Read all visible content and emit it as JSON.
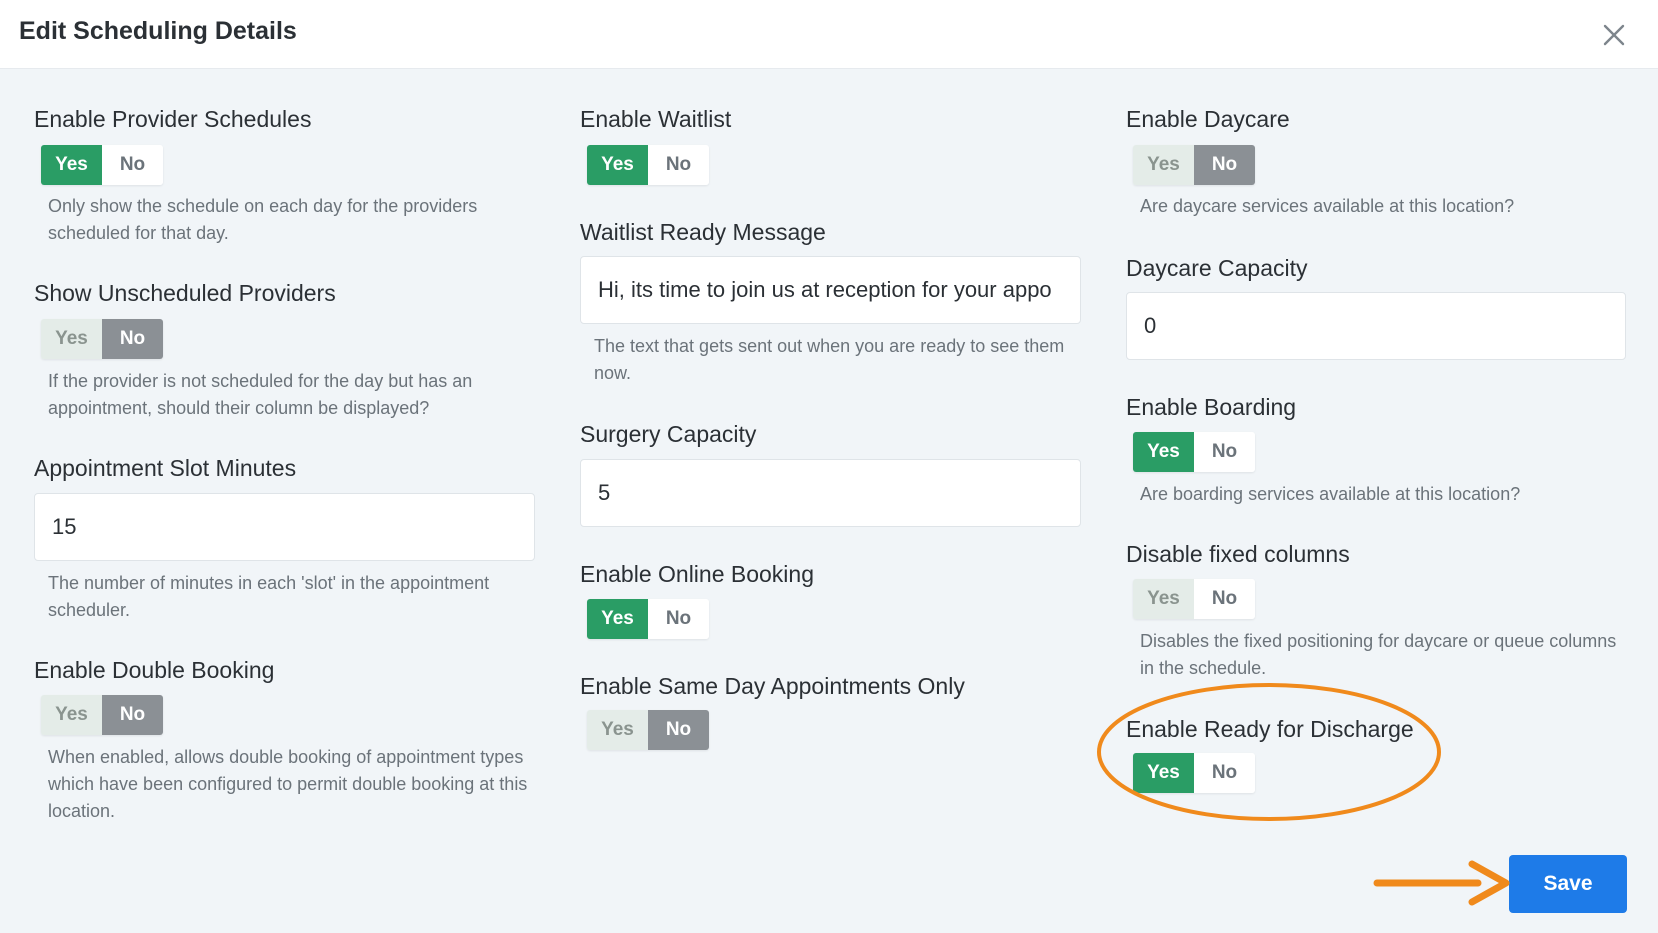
{
  "header": {
    "title": "Edit Scheduling Details"
  },
  "col1": {
    "provider_schedules": {
      "label": "Enable Provider Schedules",
      "yes": "Yes",
      "no": "No",
      "selected": "Yes",
      "help": "Only show the schedule on each day for the providers scheduled for that day."
    },
    "unscheduled_providers": {
      "label": "Show Unscheduled Providers",
      "yes": "Yes",
      "no": "No",
      "selected": "No",
      "help": "If the provider is not scheduled for the day but has an appointment, should their column be displayed?"
    },
    "slot_minutes": {
      "label": "Appointment Slot Minutes",
      "value": "15",
      "help": "The number of minutes in each 'slot' in the appointment scheduler."
    },
    "double_booking": {
      "label": "Enable Double Booking",
      "yes": "Yes",
      "no": "No",
      "selected": "No",
      "help": "When enabled, allows double booking of appointment types which have been configured to permit double booking at this location."
    }
  },
  "col2": {
    "waitlist": {
      "label": "Enable Waitlist",
      "yes": "Yes",
      "no": "No",
      "selected": "Yes"
    },
    "waitlist_message": {
      "label": "Waitlist Ready Message",
      "value": "Hi, its time to join us at reception for your appo",
      "help": "The text that gets sent out when you are ready to see them now."
    },
    "surgery_capacity": {
      "label": "Surgery Capacity",
      "value": "5"
    },
    "online_booking": {
      "label": "Enable Online Booking",
      "yes": "Yes",
      "no": "No",
      "selected": "Yes"
    },
    "same_day": {
      "label": "Enable Same Day Appointments Only",
      "yes": "Yes",
      "no": "No",
      "selected": "No"
    }
  },
  "col3": {
    "daycare": {
      "label": "Enable Daycare",
      "yes": "Yes",
      "no": "No",
      "selected": "No",
      "help": "Are daycare services available at this location?"
    },
    "daycare_capacity": {
      "label": "Daycare Capacity",
      "value": "0"
    },
    "boarding": {
      "label": "Enable Boarding",
      "yes": "Yes",
      "no": "No",
      "selected": "Yes",
      "help": "Are boarding services available at this location?"
    },
    "fixed_columns": {
      "label": "Disable fixed columns",
      "yes": "Yes",
      "no": "No",
      "selected": "none",
      "help": "Disables the fixed positioning for daycare or queue columns in the schedule."
    },
    "ready_discharge": {
      "label": "Enable Ready for Discharge",
      "yes": "Yes",
      "no": "No",
      "selected": "Yes"
    }
  },
  "footer": {
    "save_label": "Save"
  },
  "colors": {
    "yes_active": "#2a9d65",
    "no_active": "#8b9095",
    "save_button": "#1e7be8",
    "annotation": "#f08a1c"
  }
}
